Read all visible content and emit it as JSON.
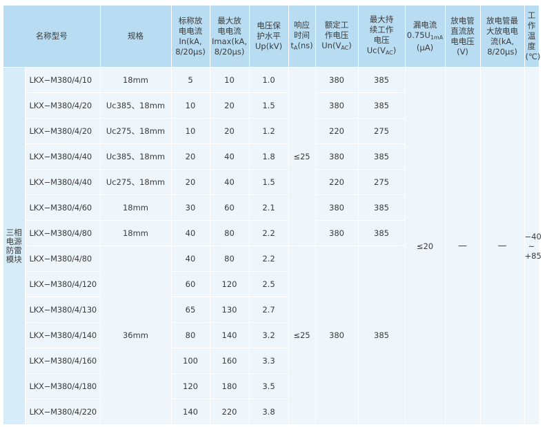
{
  "headers": {
    "group": "名称型号",
    "spec": "规格",
    "in_line1": "标称放",
    "in_line2": "电电流",
    "in_line3": "In(kA,",
    "in_line4": "8/20μs)",
    "imax_line1": "最大放",
    "imax_line2": "电电流",
    "imax_line3": "Imax(kA,",
    "imax_line4": "8/20μs)",
    "up_line1": "电压保",
    "up_line2": "护水平",
    "up_line3": "Up(kV)",
    "ta_line1": "响应",
    "ta_line2": "时间",
    "ta_line3_pre": "t",
    "ta_line3_sub": "A",
    "ta_line3_post": "(ns)",
    "un_line1": "额定工",
    "un_line2": "作电压",
    "un_line3_pre": "Un(V",
    "un_line3_sub": "AC",
    "un_line3_post": ")",
    "uc_line1": "最大持",
    "uc_line2": "续工作",
    "uc_line3": "电压",
    "uc_line4_pre": "Uc(V",
    "uc_line4_sub": "AC",
    "uc_line4_post": ")",
    "leak_line1": "漏电流",
    "leak_line2_pre": "0.75U",
    "leak_line2_sub": "1mA",
    "leak_line3": "(μA)",
    "dc_line1": "放电管",
    "dc_line2": "直流放",
    "dc_line3": "电电压",
    "dc_line4": "(V)",
    "gdt_line1": "放电管最",
    "gdt_line2": "大放电电",
    "gdt_line3": "流(kA,",
    "gdt_line4": "8/20μs)",
    "temp_line1": "工作",
    "temp_line2": "温度",
    "temp_line3": "(℃)"
  },
  "group_label": "三相电源防雷模块",
  "merged": {
    "ta_top": "≤25",
    "ta_bottom": "≤25",
    "spec_bottom": "36mm",
    "un_bottom": "380",
    "uc_bottom": "385",
    "leak": "≤20",
    "dc": "—",
    "gdt": "—",
    "temp_line1": "−40",
    "temp_line2": "~",
    "temp_line3": "+85"
  },
  "rows": [
    {
      "name": "LKX−M380/4/10",
      "spec": "18mm",
      "in": "5",
      "imax": "10",
      "up": "1.0",
      "un": "380",
      "uc": "385"
    },
    {
      "name": "LKX−M380/4/20",
      "spec": "Uc385、18mm",
      "in": "10",
      "imax": "20",
      "up": "1.5",
      "un": "380",
      "uc": "385"
    },
    {
      "name": "LKX−M380/4/20",
      "spec": "Uc275、18mm",
      "in": "10",
      "imax": "20",
      "up": "1.2",
      "un": "220",
      "uc": "275"
    },
    {
      "name": "LKX−M380/4/40",
      "spec": "Uc385、18mm",
      "in": "20",
      "imax": "40",
      "up": "1.8",
      "un": "380",
      "uc": "385"
    },
    {
      "name": "LKX−M380/4/40",
      "spec": "Uc275、18mm",
      "in": "20",
      "imax": "40",
      "up": "1.5",
      "un": "220",
      "uc": "275"
    },
    {
      "name": "LKX−M380/4/60",
      "spec": "18mm",
      "in": "30",
      "imax": "60",
      "up": "2.1",
      "un": "380",
      "uc": "385"
    },
    {
      "name": "LKX−M380/4/80",
      "spec": "18mm",
      "in": "40",
      "imax": "80",
      "up": "2.2",
      "un": "380",
      "uc": "385"
    },
    {
      "name": "LKX−M380/4/80",
      "in": "40",
      "imax": "80",
      "up": "2.2"
    },
    {
      "name": "LKX−M380/4/120",
      "in": "60",
      "imax": "120",
      "up": "2.5"
    },
    {
      "name": "LKX−M380/4/130",
      "in": "65",
      "imax": "130",
      "up": "2.7"
    },
    {
      "name": "LKX−M380/4/140",
      "in": "80",
      "imax": "140",
      "up": "3.2"
    },
    {
      "name": "LKX−M380/4/160",
      "in": "100",
      "imax": "160",
      "up": "3.3"
    },
    {
      "name": "LKX−M380/4/180",
      "in": "120",
      "imax": "180",
      "up": "3.5"
    },
    {
      "name": "LKX−M380/4/220",
      "in": "140",
      "imax": "220",
      "up": "3.8"
    }
  ]
}
